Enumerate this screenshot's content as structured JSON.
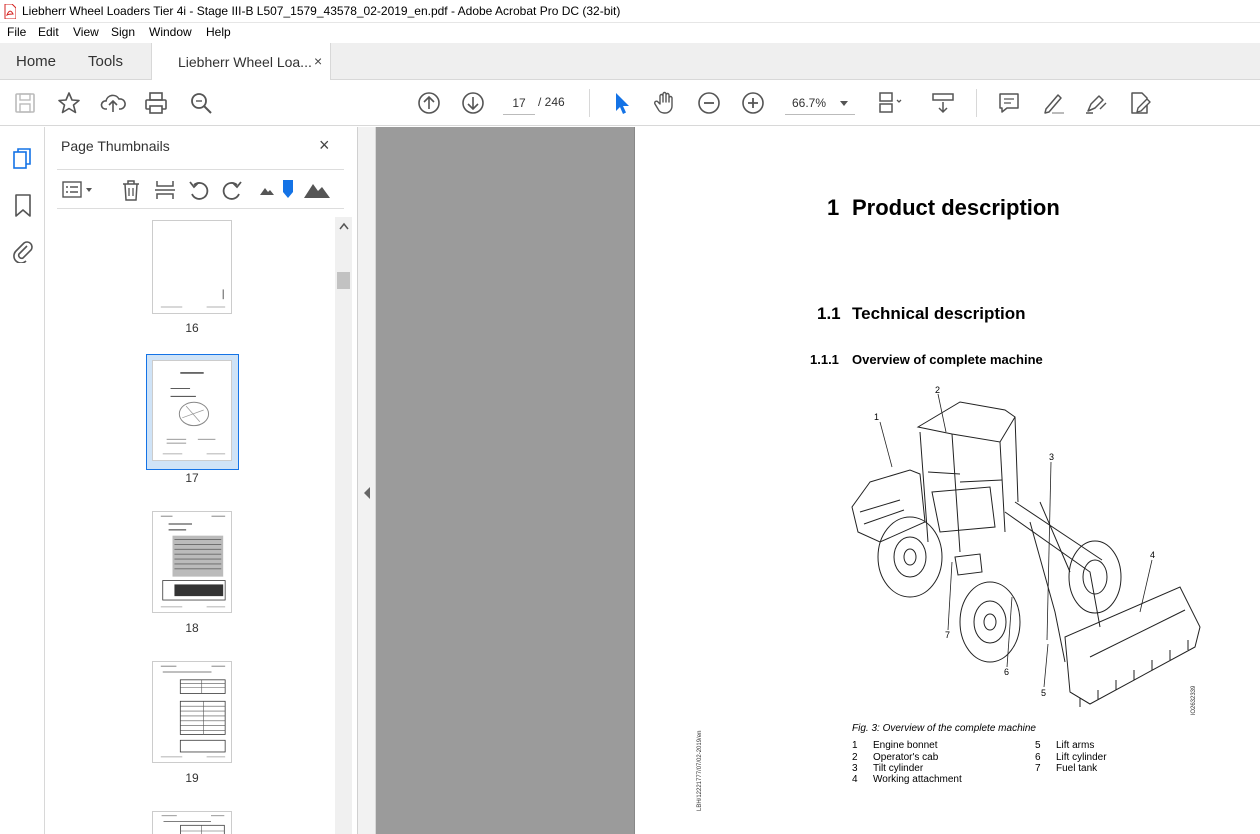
{
  "window": {
    "title": "Liebherr Wheel Loaders Tier 4i - Stage III-B L507_1579_43578_02-2019_en.pdf - Adobe Acrobat Pro DC (32-bit)"
  },
  "menu": [
    "File",
    "Edit",
    "View",
    "Sign",
    "Window",
    "Help"
  ],
  "tabs": {
    "home": "Home",
    "tools": "Tools",
    "document": "Liebherr Wheel Loa...",
    "close": "×"
  },
  "toolbar": {
    "page_current": "17",
    "page_total": "/ 246",
    "zoom": "66.7%"
  },
  "panel": {
    "title": "Page Thumbnails",
    "close": "×",
    "thumbnails": [
      {
        "number": "16"
      },
      {
        "number": "17",
        "selected": true
      },
      {
        "number": "18"
      },
      {
        "number": "19"
      }
    ]
  },
  "document": {
    "h1_num": "1",
    "h1": "Product description",
    "h2_num": "1.1",
    "h2": "Technical description",
    "h3_num": "1.1.1",
    "h3": "Overview of complete machine",
    "callouts": [
      "1",
      "2",
      "3",
      "4",
      "5",
      "6",
      "7"
    ],
    "figure_id": "lO2632339",
    "side_text": "LBH/12221777/07/02-2019/en",
    "caption": "Fig. 3: Overview of the complete machine",
    "legend_left": [
      {
        "num": "1",
        "label": "Engine bonnet"
      },
      {
        "num": "2",
        "label": "Operator's cab"
      },
      {
        "num": "3",
        "label": "Tilt cylinder"
      },
      {
        "num": "4",
        "label": "Working attachment"
      }
    ],
    "legend_right": [
      {
        "num": "5",
        "label": "Lift arms"
      },
      {
        "num": "6",
        "label": "Lift cylinder"
      },
      {
        "num": "7",
        "label": "Fuel tank"
      }
    ]
  },
  "colors": {
    "accent": "#1473e6",
    "pdf_red": "#d4211f",
    "selection": "#cfe3f7"
  }
}
